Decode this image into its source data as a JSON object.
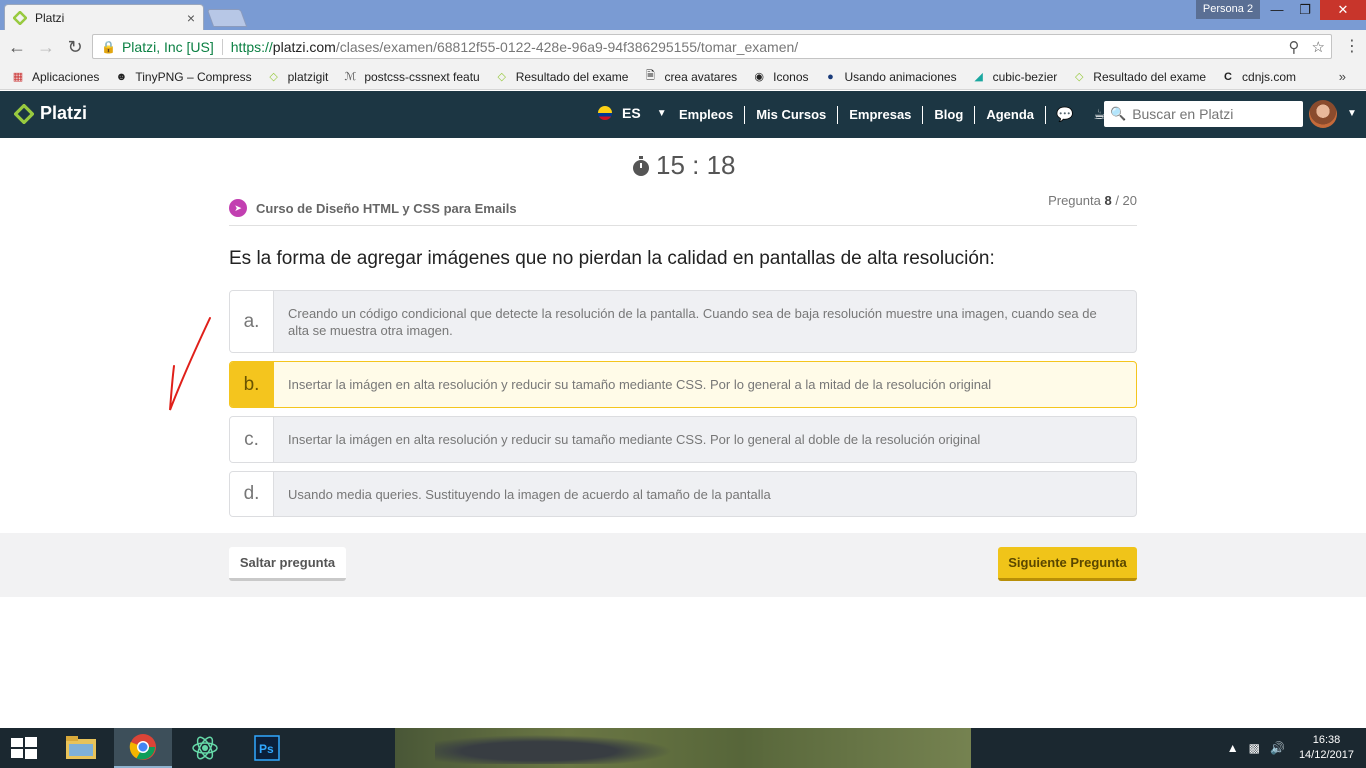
{
  "browser": {
    "tab_title": "Platzi",
    "tab_close": "×",
    "profile": "Persona 2",
    "site_identity": "Platzi, Inc [US]",
    "url_protocol": "https://",
    "url_host": "platzi.com",
    "url_path": "/clases/examen/68812f55-0122-428e-96a9-94f386295155/tomar_examen/",
    "bookmarks": [
      {
        "label": "Aplicaciones",
        "icon": "apps-grid-icon"
      },
      {
        "label": "TinyPNG – Compress",
        "icon": "panda-icon"
      },
      {
        "label": "platzigit",
        "icon": "platzi-icon"
      },
      {
        "label": "postcss-cssnext featu",
        "icon": "postcss-icon"
      },
      {
        "label": "Resultado del exame",
        "icon": "platzi-icon"
      },
      {
        "label": "crea avatares",
        "icon": "page-icon"
      },
      {
        "label": "Iconos",
        "icon": "glasses-icon"
      },
      {
        "label": "Usando animaciones",
        "icon": "firefox-icon"
      },
      {
        "label": "cubic-bezier",
        "icon": "cubic-bezier-icon"
      },
      {
        "label": "Resultado del exame",
        "icon": "platzi-icon"
      },
      {
        "label": "cdnjs.com",
        "icon": "cdnjs-icon"
      }
    ],
    "bookmarks_more": "»"
  },
  "platzi_nav": {
    "logo": "Platzi",
    "language": "ES",
    "links": [
      "Empleos",
      "Mis Cursos",
      "Empresas",
      "Blog",
      "Agenda"
    ],
    "search_placeholder": "Buscar en Platzi"
  },
  "exam": {
    "timer": "15 : 18",
    "course_name": "Curso de Diseño HTML y CSS para Emails",
    "question_label": "Pregunta",
    "question_current": "8",
    "question_total": "/ 20",
    "question": "Es la forma de agregar imágenes que no pierdan la calidad en pantallas de alta resolución:",
    "options": [
      {
        "letter": "a.",
        "text": "Creando un código condicional que detecte la resolución de la pantalla. Cuando sea de baja resolución muestre una imagen, cuando sea de alta se muestra otra imagen."
      },
      {
        "letter": "b.",
        "text": "Insertar la imágen en alta resolución y reducir su tamaño mediante CSS. Por lo general a la mitad de la resolución original"
      },
      {
        "letter": "c.",
        "text": "Insertar la imágen en alta resolución y reducir su tamaño mediante CSS. Por lo general al doble de la resolución original"
      },
      {
        "letter": "d.",
        "text": "Usando media queries. Sustituyendo la imagen de acuerdo al tamaño de la pantalla"
      }
    ],
    "selected_option": "b.",
    "skip_button": "Saltar pregunta",
    "next_button": "Siguiente Pregunta"
  },
  "taskbar": {
    "time": "16:38",
    "date": "14/12/2017"
  },
  "colors": {
    "platzi_nav_bg": "#1c3643",
    "platzi_green": "#98ca3f",
    "selected_yellow": "#f4c51e",
    "next_button": "#f0c419",
    "annotation_red": "#e0201a"
  }
}
